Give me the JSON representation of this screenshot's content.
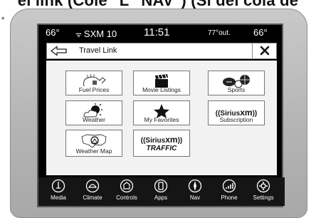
{
  "banner_text": "el link (Cole \"L\" NAV\") (Si del cola de",
  "banner_marker": "*",
  "status_bar": {
    "left_temp": "66°",
    "radio_station": "SXM 10",
    "clock": "11:51",
    "outside_temp": "77°out.",
    "right_temp": "66°"
  },
  "header": {
    "title": "Travel Link",
    "back_icon": "back-arrow-icon",
    "close_icon": "close-icon"
  },
  "tiles": [
    {
      "label": "Fuel Prices",
      "icon": "fuel-pump-icon"
    },
    {
      "label": "Movie Listings",
      "icon": "clapperboard-icon"
    },
    {
      "label": "Sports",
      "icon": "sports-balls-icon"
    },
    {
      "label": "Weather",
      "icon": "weather-sun-cloud-icon"
    },
    {
      "label": "My Favorites",
      "icon": "star-icon"
    },
    {
      "label": "Subscription",
      "logo": "((Sirius",
      "logo_suffix": "xm",
      "logo_end": "))"
    },
    {
      "label": "Weather Map",
      "icon": "map-icon"
    },
    {
      "label": "",
      "logo": "((Sirius",
      "logo_suffix": "xm",
      "logo_end": "))",
      "logo_sub": "TRAFFIC"
    }
  ],
  "nav": [
    {
      "label": "Media",
      "icon": "media-icon"
    },
    {
      "label": "Climate",
      "icon": "climate-icon"
    },
    {
      "label": "Controls",
      "icon": "controls-icon"
    },
    {
      "label": "Apps",
      "icon": "apps-icon"
    },
    {
      "label": "Nav",
      "icon": "nav-compass-icon"
    },
    {
      "label": "Phone",
      "icon": "phone-icon"
    },
    {
      "label": "Settings",
      "icon": "settings-gear-icon"
    }
  ],
  "colors": {
    "screen": "#000000",
    "tile_bg": "#ffffff",
    "bezel": "#b8b8b8"
  }
}
